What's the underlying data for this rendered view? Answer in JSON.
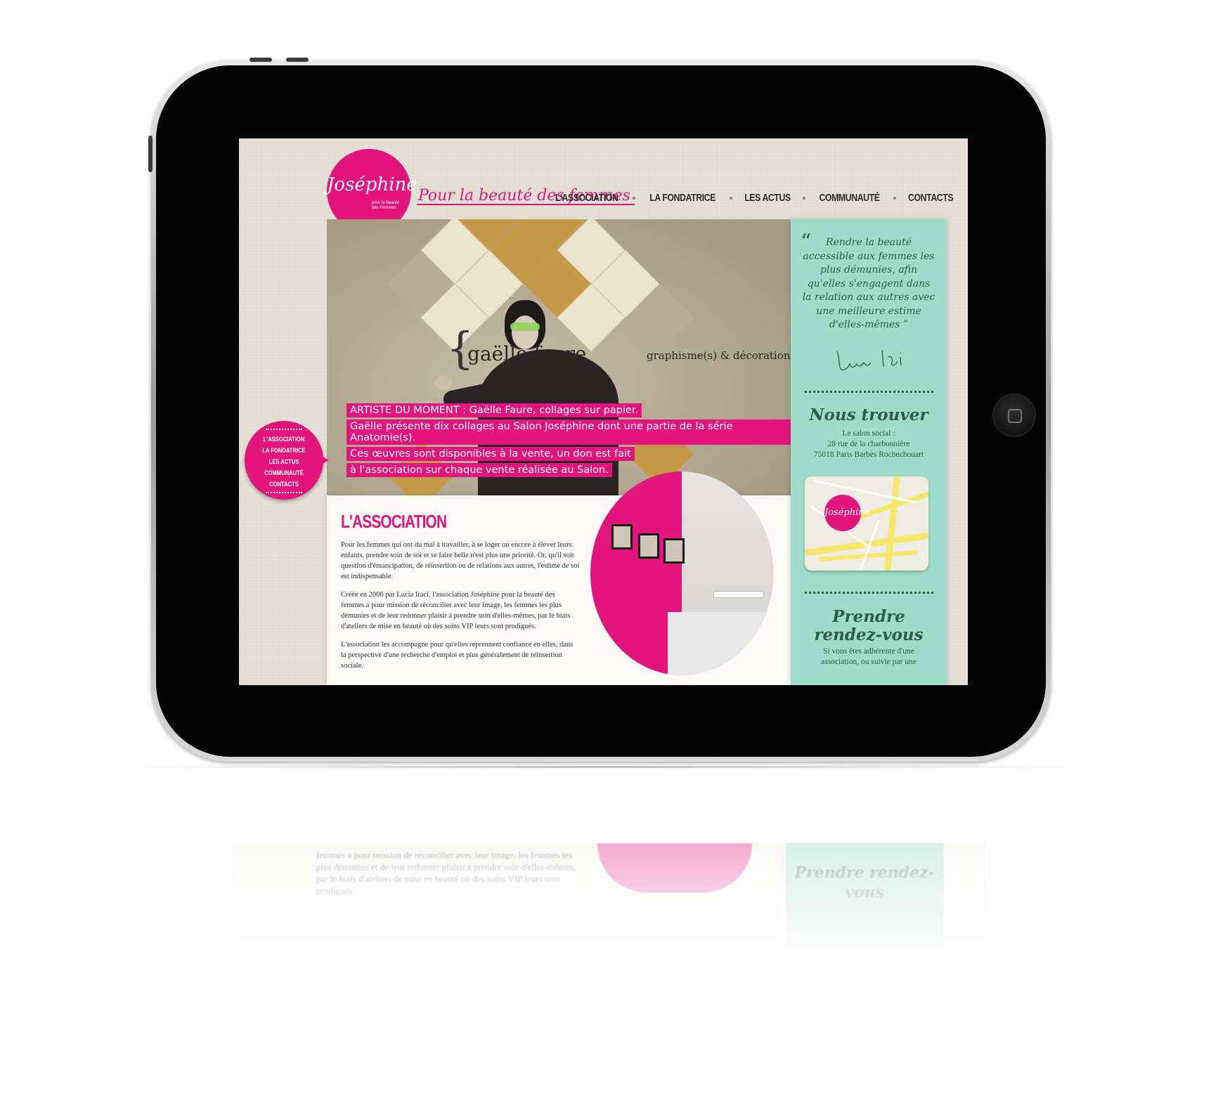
{
  "site": {
    "logo_text": "Joséphine",
    "logo_subtext": "pour la Beauté des Femmes",
    "tagline": "Pour la beauté des femmes"
  },
  "nav": {
    "items": [
      {
        "label": "L'ASSOCIATION"
      },
      {
        "label": "LA FONDATRICE"
      },
      {
        "label": "LES ACTUS"
      },
      {
        "label": "COMMUNAUTÉ"
      },
      {
        "label": "CONTACTS"
      }
    ]
  },
  "side_menu": {
    "items": [
      {
        "label": "L'ASSOCIATION"
      },
      {
        "label": "LA FONDATRICE"
      },
      {
        "label": "LES ACTUS"
      },
      {
        "label": "COMMUNAUTÉ"
      },
      {
        "label": "CONTACTS"
      }
    ]
  },
  "hero": {
    "brace": "{",
    "artist_name": "gaëlle faure",
    "artist_subtitle": "graphisme(s) & décoration",
    "caption_lines": [
      "ARTISTE DU MOMENT : Gaëlle Faure, collages sur papier.",
      "Gaëlle présente dix collages au Salon Joséphine dont une partie de la série Anatomie(s).",
      "Ces œuvres sont disponibles à la vente, un don est fait",
      "à l'association sur chaque vente réalisée au Salon."
    ]
  },
  "association": {
    "title": "L'ASSOCIATION",
    "paragraphs": [
      "Pour les femmes qui ont du mal à travailler, à se loger ou encore à élever leurs enfants, prendre soin de soi et se faire belle n'est plus une priorité. Or, qu'il soit question d'émancipation, de réinsertion ou de relations aux autres, l'estime de soi est indispensable.",
      "Créée en 2006 par Lucia Iraci, l'association Joséphine pour la beauté des femmes a pour mission de réconcilier avec leur image, les femmes les plus démunies et de leur redonner plaisir à prendre soin d'elles-mêmes, par le biais d'ateliers de mise en beauté où des soins VIP leurs sont prodigués.",
      "L'association les accompagne pour qu'elles reprennent confiance en elles, dans la perspective d'une recherche d'emploi et plus généralement de réinsertion sociale."
    ]
  },
  "sidebar": {
    "quote_open": "“",
    "quote": "Rendre la beauté accessible aux femmes les plus démunies, afin qu'elles s'engagent dans la relation aux autres avec une meilleure estime d'elles-mêmes ”",
    "find_us_title": "Nous trouver",
    "address_lines": [
      "Le salon social :",
      "28 rue de la charbonnière",
      "75018 Paris Barbès Rochechouart"
    ],
    "map_logo": "Joséphine",
    "appointment_title": "Prendre rendez-vous",
    "appointment_text": "Si vous êtes adhérente d'une association, ou suivie par une"
  },
  "reflection": {
    "text": "femmes a pour mission de réconcilier avec leur image, les femmes les plus démunies et de leur redonner plaisir à prendre soin d'elles-mêmes, par le biais d'ateliers de mise en beauté où des soins VIP leurs sont prodigués.",
    "heading": "Prendre rendez-vous"
  },
  "colors": {
    "brand_pink": "#e4147d",
    "mint": "#9edcc9",
    "dark_green": "#2c5d47",
    "linen": "#e7e2d8"
  }
}
